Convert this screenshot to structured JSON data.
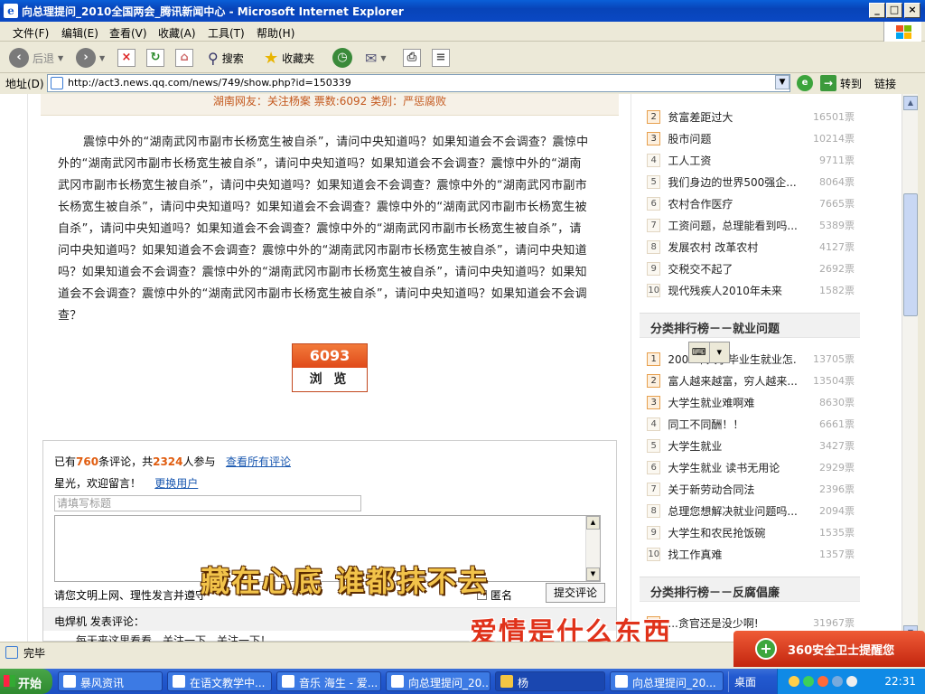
{
  "window": {
    "title": "向总理提问_2010全国两会_腾讯新闻中心 - Microsoft Internet Explorer",
    "btn_min": "_",
    "btn_max": "□",
    "btn_close": "×"
  },
  "menu": [
    "文件(F)",
    "编辑(E)",
    "查看(V)",
    "收藏(A)",
    "工具(T)",
    "帮助(H)"
  ],
  "toolbar": {
    "back_label": "后退",
    "search_label": "搜索",
    "favorites_label": "收藏夹"
  },
  "address": {
    "label": "地址(D)",
    "url": "http://act3.news.qq.com/news/749/show.php?id=150339",
    "go_label": "转到",
    "links_label": "链接"
  },
  "article": {
    "meta": "湖南网友：关注杨案      票数:6092      类别：严惩腐败",
    "body": "震惊中外的“湖南武冈市副市长杨宽生被自杀”，请问中央知道吗？如果知道会不会调查？震惊中外的“湖南武冈市副市长杨宽生被自杀”，请问中央知道吗？如果知道会不会调查？震惊中外的“湖南武冈市副市长杨宽生被自杀”，请问中央知道吗？如果知道会不会调查？震惊中外的“湖南武冈市副市长杨宽生被自杀”，请问中央知道吗？如果知道会不会调查？震惊中外的“湖南武冈市副市长杨宽生被自杀”，请问中央知道吗？如果知道会不会调查？震惊中外的“湖南武冈市副市长杨宽生被自杀”，请问中央知道吗？如果知道会不会调查？震惊中外的“湖南武冈市副市长杨宽生被自杀”，请问中央知道吗？如果知道会不会调查？震惊中外的“湖南武冈市副市长杨宽生被自杀”，请问中央知道吗？如果知道会不会调查？震惊中外的“湖南武冈市副市长杨宽生被自杀”，请问中央知道吗？如果知道会不会调查？",
    "views": "6093",
    "views_label": "浏 览"
  },
  "comments": {
    "prefix": "已有",
    "count": "760",
    "mid": "条评论，共",
    "participants": "2324",
    "suffix": "人参与",
    "view_all": "查看所有评论",
    "welcome": "星光，欢迎留言！",
    "change_user": "更换用户",
    "title_placeholder": "请填写标题",
    "civil_notice": "请您文明上网、理性发言并遵守",
    "anonymous": "匿名",
    "submit": "提交评论",
    "list_header": "电焊机  发表评论：",
    "first_comment": "每天来这里看看，关注一下，关注一下！"
  },
  "sidebar": {
    "list1": [
      {
        "rank": "2",
        "text": "贫富差距过大",
        "votes": "16501票"
      },
      {
        "rank": "3",
        "text": "股市问题",
        "votes": "10214票"
      },
      {
        "rank": "4",
        "text": "工人工资",
        "votes": "9711票"
      },
      {
        "rank": "5",
        "text": "我们身边的世界500强企...",
        "votes": "8064票"
      },
      {
        "rank": "6",
        "text": "农村合作医疗",
        "votes": "7665票"
      },
      {
        "rank": "7",
        "text": "工资问题，总理能看到吗...",
        "votes": "5389票"
      },
      {
        "rank": "8",
        "text": "发展农村  改革农村",
        "votes": "4127票"
      },
      {
        "rank": "9",
        "text": "交税交不起了",
        "votes": "2692票"
      },
      {
        "rank": "10",
        "text": "现代残疾人2010年未来",
        "votes": "1582票"
      }
    ],
    "heading2": "分类排行榜－－就业问题",
    "list2": [
      {
        "rank": "1",
        "text": "2009年大学毕业生就业怎...",
        "votes": "13705票"
      },
      {
        "rank": "2",
        "text": "富人越来越富，穷人越来...",
        "votes": "13504票"
      },
      {
        "rank": "3",
        "text": "大学生就业难啊难",
        "votes": "8630票"
      },
      {
        "rank": "4",
        "text": "同工不同酬！！",
        "votes": "6661票"
      },
      {
        "rank": "5",
        "text": "大学生就业",
        "votes": "3427票"
      },
      {
        "rank": "6",
        "text": "大学生就业  读书无用论",
        "votes": "2929票"
      },
      {
        "rank": "7",
        "text": "关于新劳动合同法",
        "votes": "2396票"
      },
      {
        "rank": "8",
        "text": "总理您想解决就业问题吗...",
        "votes": "2094票"
      },
      {
        "rank": "9",
        "text": "大学生和农民抢饭碗",
        "votes": "1535票"
      },
      {
        "rank": "10",
        "text": "找工作真难",
        "votes": "1357票"
      }
    ],
    "heading3": "分类排行榜－－反腐倡廉",
    "list3_first": {
      "text": "...贪官还是没少啊!",
      "votes": "31967票"
    }
  },
  "overlays": {
    "subtitle1": "藏在心底  谁都抹不去",
    "subtitle2": "爱情是什么东西",
    "toast_360": "360安全卫士提醒您"
  },
  "status": {
    "text": "完毕"
  },
  "taskbar": {
    "start": "开始",
    "tasks": [
      "暴风资讯",
      "在语文教学中...",
      "音乐 海生 - 爱...",
      "向总理提问_20...",
      "杨",
      "向总理提问_20..."
    ],
    "desktop": "桌面",
    "clock": "22:31"
  }
}
